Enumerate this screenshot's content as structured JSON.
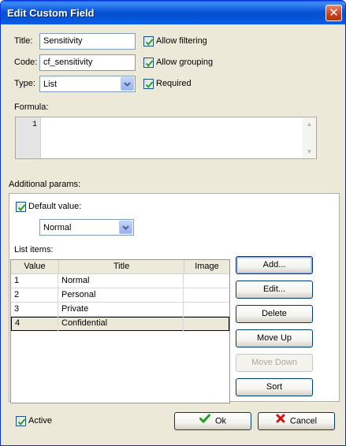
{
  "window": {
    "title": "Edit Custom Field",
    "close_glyph": "✕"
  },
  "fields": {
    "title_label": "Title:",
    "title_value": "Sensitivity",
    "code_label": "Code:",
    "code_value": "cf_sensitivity",
    "type_label": "Type:",
    "type_value": "List"
  },
  "options": {
    "allow_filtering": {
      "label": "Allow filtering",
      "checked": true
    },
    "allow_grouping": {
      "label": "Allow grouping",
      "checked": true
    },
    "required": {
      "label": "Required",
      "checked": true
    }
  },
  "formula": {
    "label": "Formula:",
    "line_number": "1",
    "text": ""
  },
  "additional": {
    "label": "Additional params:",
    "default_value": {
      "label": "Default value:",
      "checked": true,
      "value": "Normal"
    },
    "list_items_label": "List items:"
  },
  "list_table": {
    "columns": [
      "Value",
      "Title",
      "Image"
    ],
    "rows": [
      {
        "value": "1",
        "title": "Normal",
        "image": ""
      },
      {
        "value": "2",
        "title": "Personal",
        "image": ""
      },
      {
        "value": "3",
        "title": "Private",
        "image": ""
      },
      {
        "value": "4",
        "title": "Confidential",
        "image": "",
        "selected": true
      }
    ]
  },
  "list_buttons": {
    "add": "Add...",
    "edit": "Edit...",
    "delete": "Delete",
    "move_up": "Move Up",
    "move_down": "Move Down",
    "sort": "Sort"
  },
  "footer": {
    "active_label": "Active",
    "active_checked": true,
    "ok": "Ok",
    "cancel": "Cancel"
  },
  "colors": {
    "title_bar": "#0a56da",
    "dialog_bg": "#ece9d8",
    "check_green": "#21a121",
    "cancel_red": "#d01010"
  },
  "icons": {
    "checkmark": "check-icon",
    "dropdown": "chevron-down-icon",
    "ok": "ok-check-icon",
    "cancel": "cancel-x-icon"
  }
}
